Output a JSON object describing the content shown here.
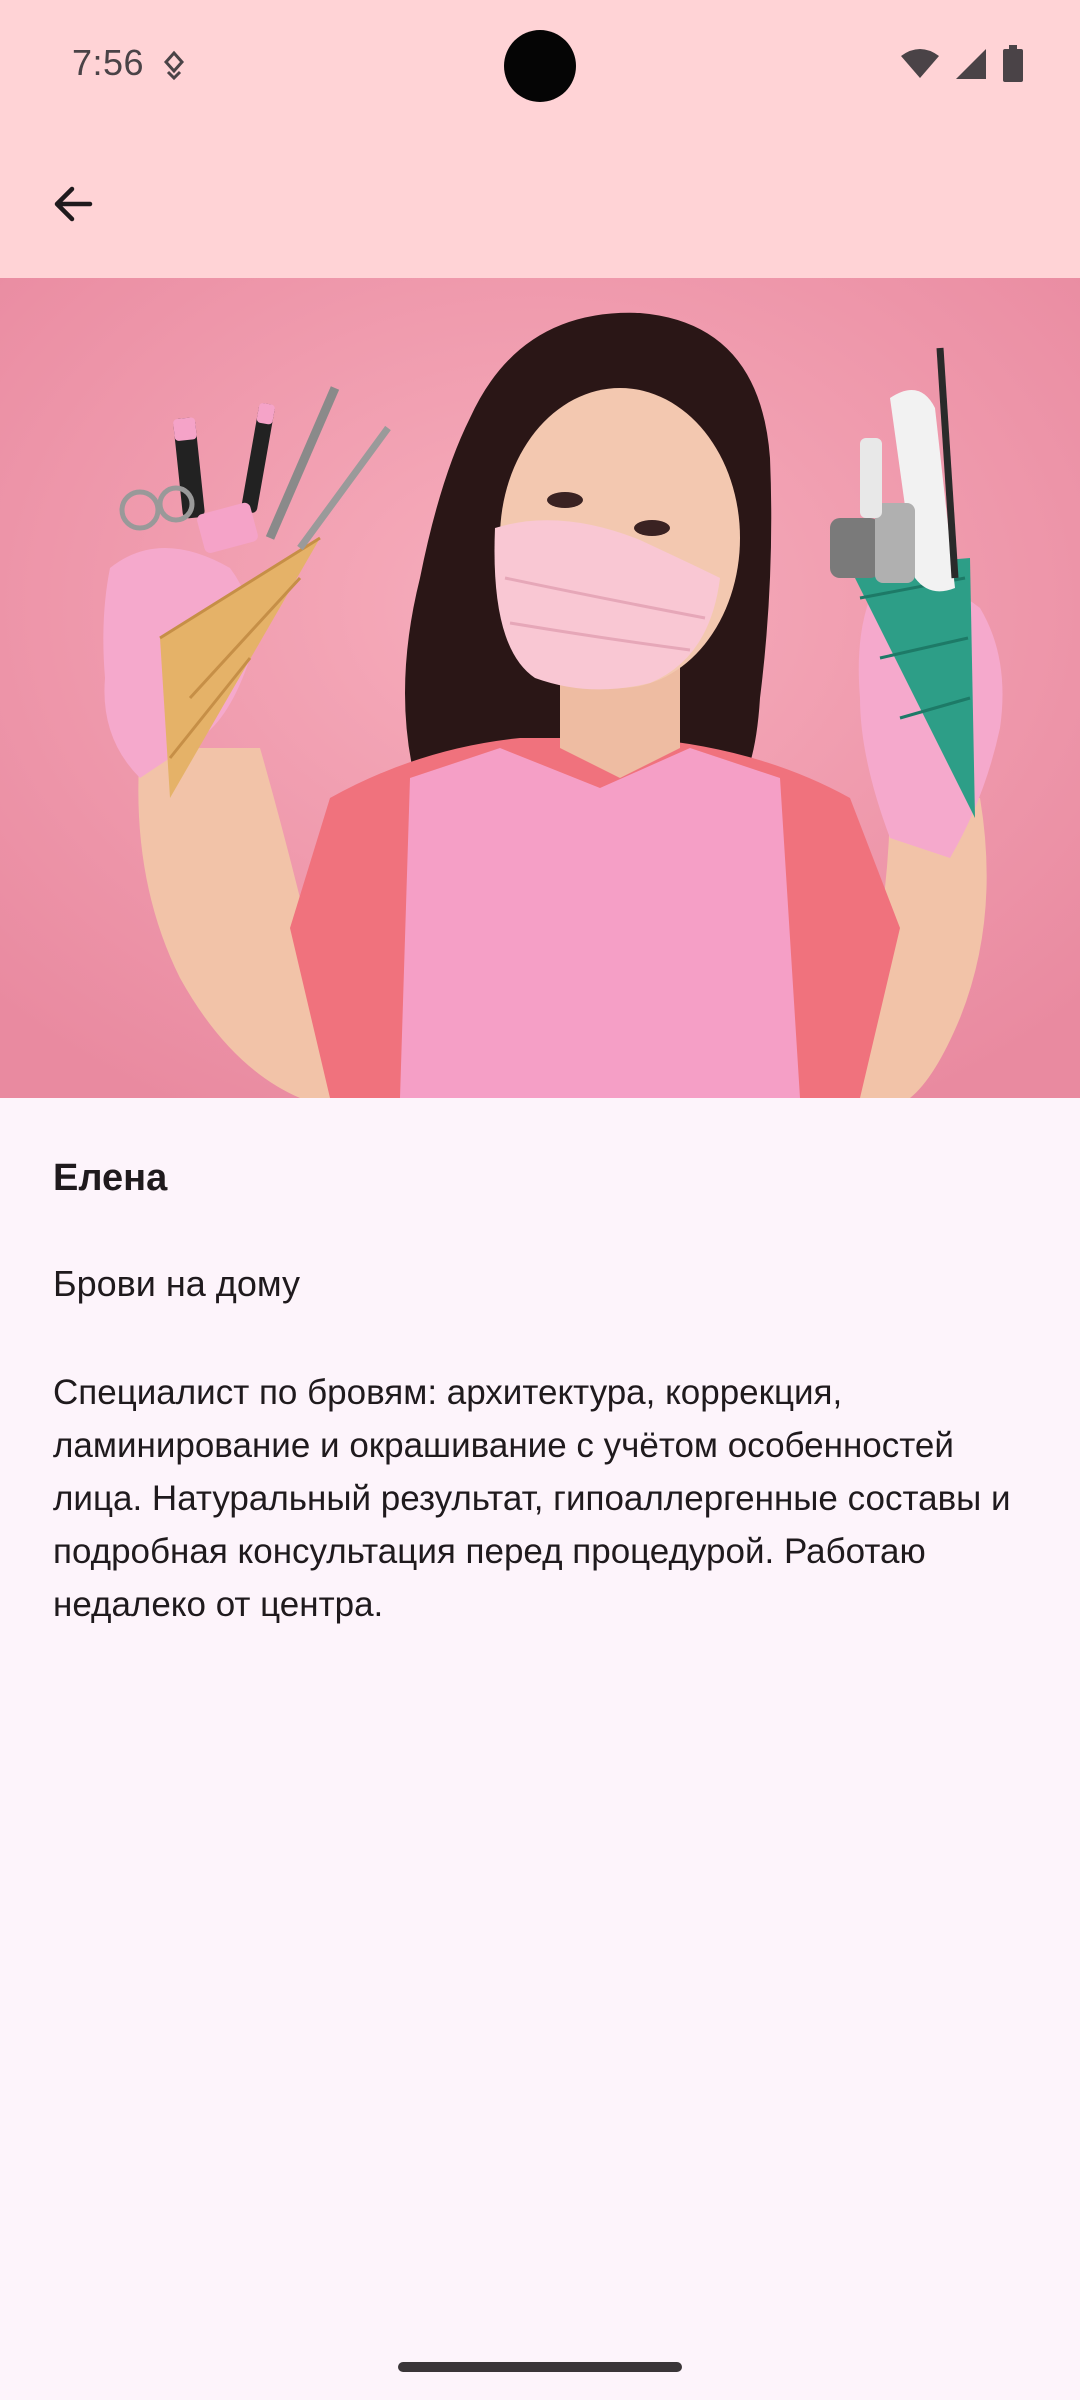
{
  "status_bar": {
    "time": "7:56",
    "icons": [
      "notification-icon",
      "wifi-icon",
      "cellular-signal-icon",
      "battery-icon"
    ]
  },
  "app_bar": {
    "back_icon": "arrow-back-icon"
  },
  "hero_image": {
    "description": "photo of a woman in a pink mask and apron holding beauty tools",
    "background_color": "#f29aae"
  },
  "profile": {
    "name": "Елена",
    "service": "Брови на дому",
    "description": "Специалист по бровям: архитектура, коррекция, ламинирование и окрашивание с учётом особенностей лица. Натуральный результат, гипоаллергенные составы и подробная консультация перед процедурой. Работаю недалеко от центра."
  },
  "colors": {
    "top_bar": "#ffd3d6",
    "page_background": "#fdf4fb",
    "text": "#1f1a1d"
  }
}
